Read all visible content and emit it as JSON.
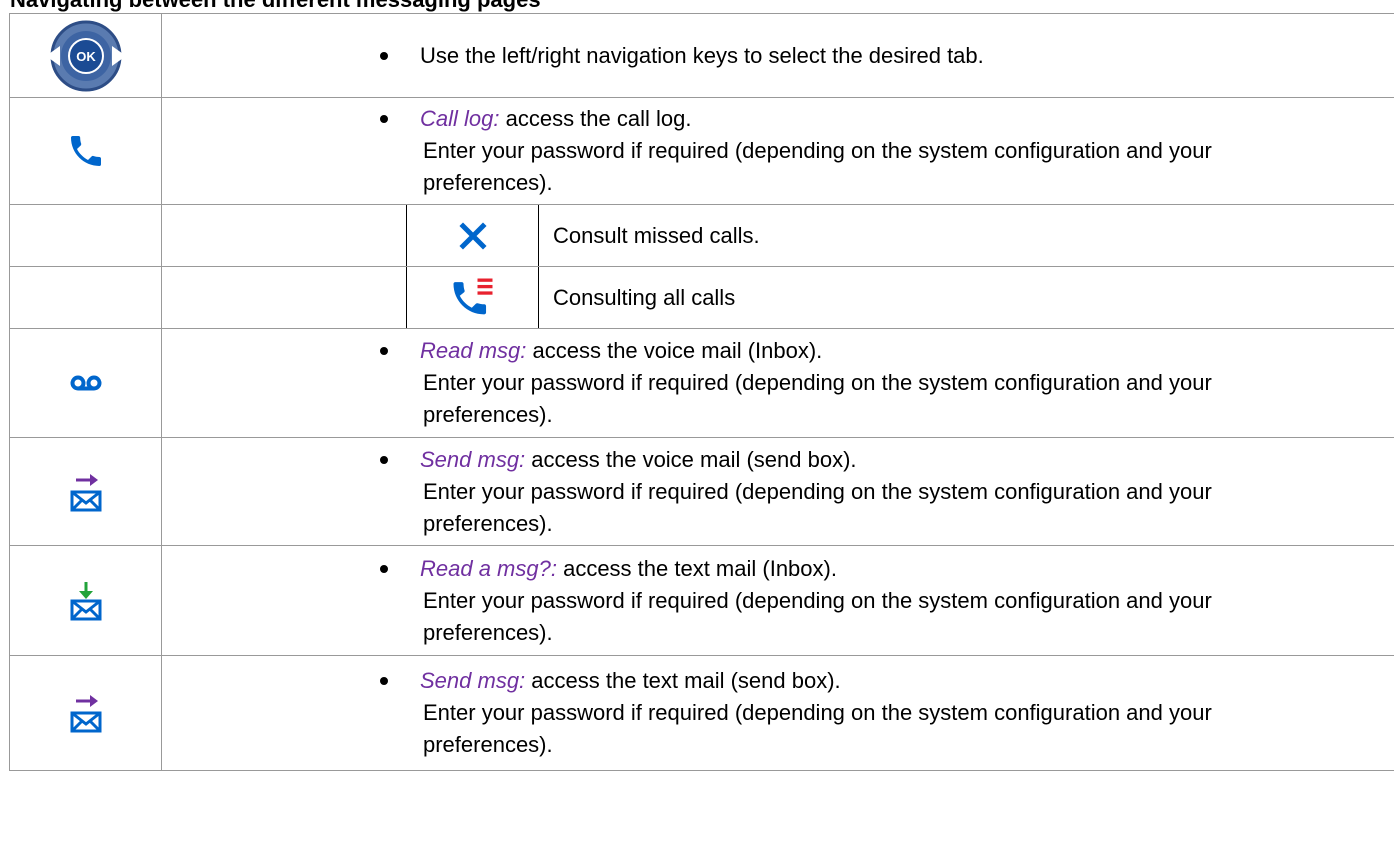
{
  "heading": "Navigating between the different messaging pages",
  "rows": {
    "nav": {
      "text": "Use the left/right navigation keys to select the desired tab.",
      "ok_label": "OK"
    },
    "calllog": {
      "title": "Call log:",
      "desc": " access the call log.",
      "line2": "Enter your password if required (depending on the system configuration and your",
      "line3": "preferences)."
    },
    "missed": {
      "text": "Consult missed calls."
    },
    "allcalls": {
      "text": "Consulting all calls"
    },
    "readvoice": {
      "title": "Read msg:",
      "desc": " access the voice mail (Inbox).",
      "line2": "Enter your password if required (depending on the system configuration and your",
      "line3": "preferences)."
    },
    "sendvoice": {
      "title": "Send msg:",
      "desc": " access the voice mail (send box).",
      "line2": "Enter your password if required (depending on the system configuration and your",
      "line3": "preferences)."
    },
    "readtext": {
      "title": "Read a msg?:",
      "desc": " access the text mail (Inbox).",
      "line2": "Enter your password if required (depending on the system configuration and your",
      "line3": "preferences)."
    },
    "sendtext": {
      "title": "Send msg:",
      "desc": " access the text mail (send box).",
      "line2": "Enter your password if required (depending on the system configuration and your",
      "line3": "preferences)."
    }
  },
  "colors": {
    "accent": "#7030a0",
    "icon_blue": "#0066cc",
    "icon_green": "#22a33a",
    "icon_red": "#e8212e"
  }
}
